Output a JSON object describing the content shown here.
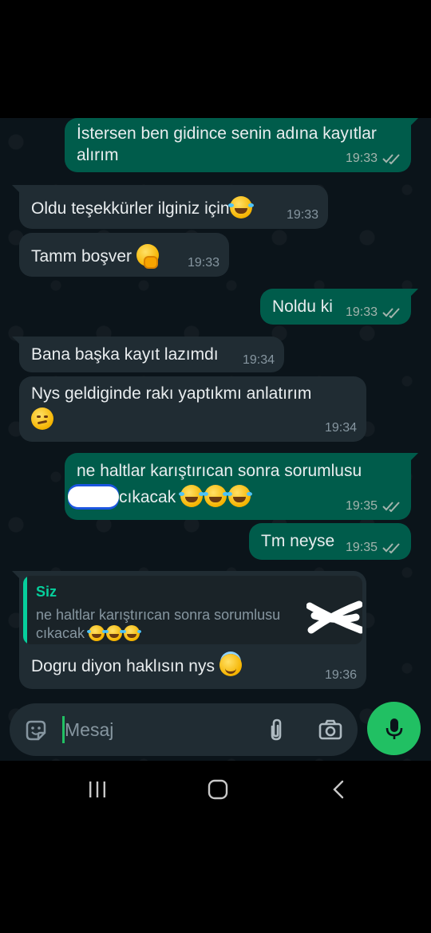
{
  "messages": [
    {
      "id": "m1",
      "dir": "out",
      "text": "İstersen ben gidince senin adına kayıtlar alırım",
      "time": "19:33",
      "status": "read"
    },
    {
      "id": "m2",
      "dir": "in",
      "text": "Oldu teşekkürler ilginiz için",
      "emoji": "laugh",
      "time": "19:33"
    },
    {
      "id": "m3",
      "dir": "in",
      "text": "Tamm boşver",
      "emoji": "shush",
      "time": "19:33"
    },
    {
      "id": "m4",
      "dir": "out",
      "text": "Noldu ki",
      "time": "19:33",
      "status": "read"
    },
    {
      "id": "m5",
      "dir": "in",
      "text": "Bana başka kayıt lazımdı",
      "time": "19:34"
    },
    {
      "id": "m6",
      "dir": "in",
      "text": "Nys geldiginde rakı yaptıkmı anlatırım",
      "emoji": "smug",
      "time": "19:34"
    },
    {
      "id": "m7",
      "dir": "out",
      "line1": "ne haltlar karıştırıcan  sonra sorumlusu",
      "line2": "cıkacak",
      "emoji": "laugh x3",
      "time": "19:35",
      "status": "read"
    },
    {
      "id": "m8",
      "dir": "out",
      "text": "Tm neyse",
      "time": "19:35",
      "status": "read"
    },
    {
      "id": "m9",
      "dir": "in",
      "reply_author": "Siz",
      "reply_text_1": "ne haltlar karıştırıcan  sonra sorumlusu",
      "reply_text_2": "cıkacak",
      "text": "Dogru diyon haklısın nys",
      "emoji": "halo",
      "time": "19:36"
    }
  ],
  "composer": {
    "placeholder": "Mesaj",
    "sticker_icon": "sticker-icon",
    "attach_icon": "paperclip-icon",
    "camera_icon": "camera-icon",
    "mic_icon": "microphone-icon"
  },
  "nav": {
    "recents": "recent-apps-icon",
    "home": "home-icon",
    "back": "back-icon"
  },
  "colors": {
    "background": "#0b141a",
    "incoming": "#202c33",
    "outgoing": "#005c4b",
    "accent": "#21c063",
    "quote_accent": "#06cf9c",
    "read_ticks": "#a3b4ad"
  }
}
